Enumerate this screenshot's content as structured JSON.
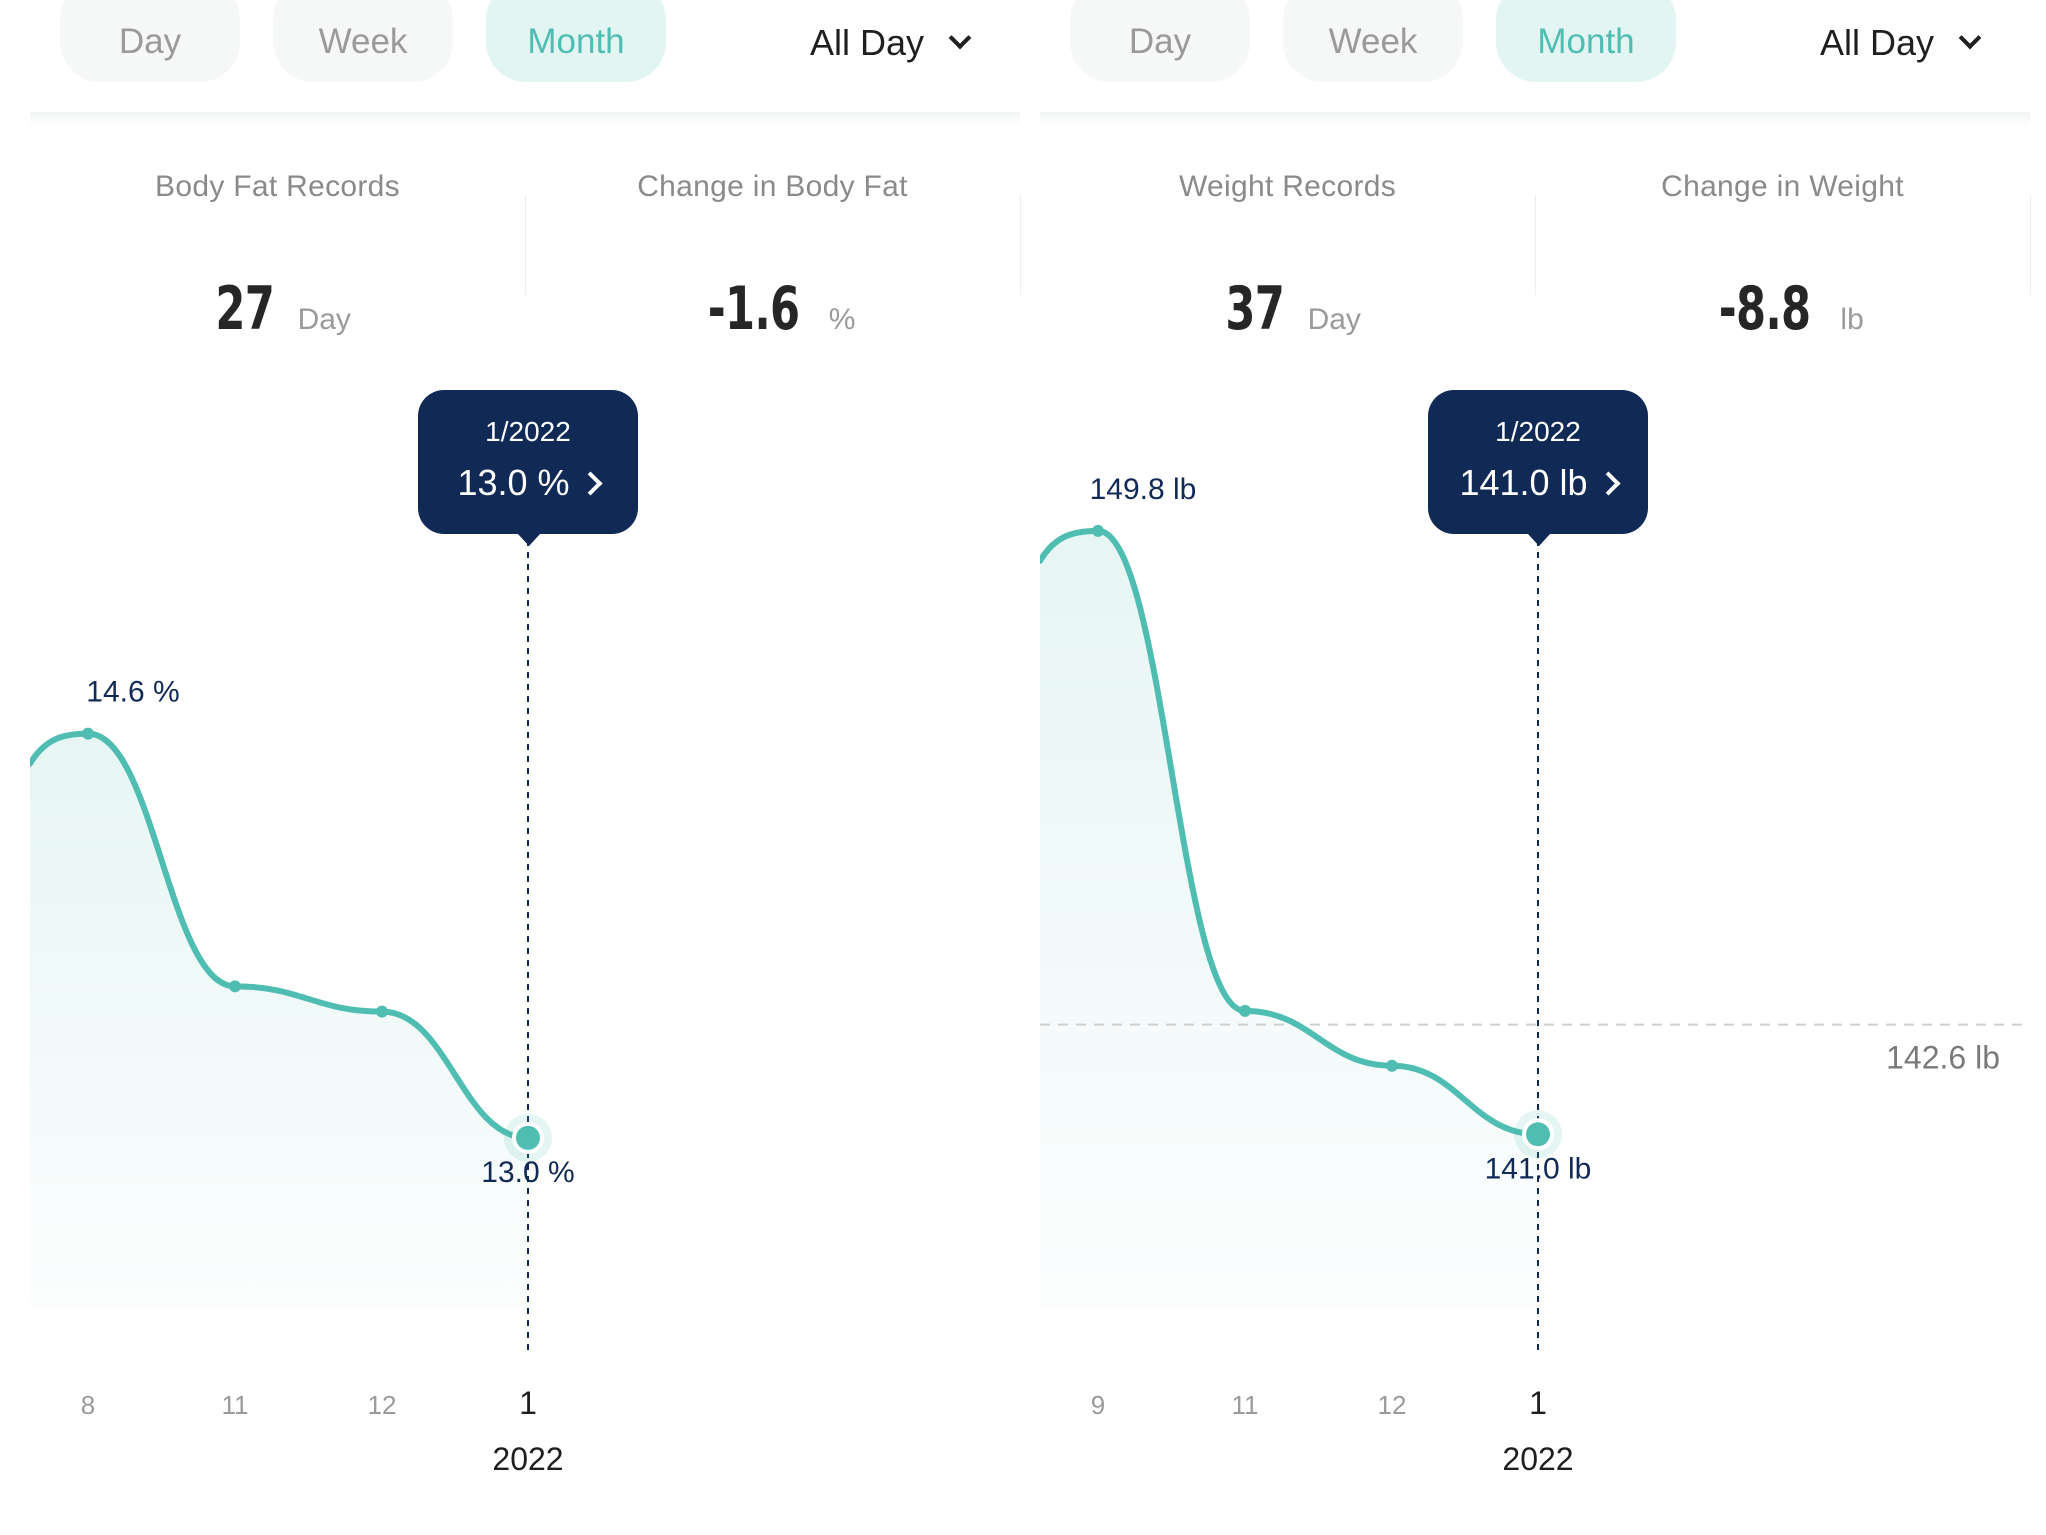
{
  "colors": {
    "accent": "#4fbdb1",
    "tooltip_bg": "#112a55",
    "label_dark": "#112a55",
    "muted": "#9a9a9a"
  },
  "panels": [
    {
      "tabs": [
        "Day",
        "Week",
        "Month"
      ],
      "active_tab": "Month",
      "period_label": "All Day",
      "stat_left": {
        "label": "Body Fat Records",
        "value": "27",
        "unit": "Day"
      },
      "stat_right": {
        "label": "Change in Body Fat",
        "value": "-1.6",
        "unit": "%"
      },
      "tooltip": {
        "date": "1/2022",
        "value": "13.0 %"
      },
      "chart_data": {
        "type": "area",
        "x": [
          "8",
          "11",
          "12",
          "1"
        ],
        "x_year_label": "2022",
        "values": [
          14.6,
          13.6,
          13.5,
          13.0
        ],
        "point_labels": [
          "14.6 %",
          "",
          "",
          "13.0 %"
        ],
        "selected_index": 3,
        "ylim": [
          12.2,
          16.0
        ]
      }
    },
    {
      "tabs": [
        "Day",
        "Week",
        "Month"
      ],
      "active_tab": "Month",
      "period_label": "All Day",
      "stat_left": {
        "label": "Weight Records",
        "value": "37",
        "unit": "Day"
      },
      "stat_right": {
        "label": "Change in Weight",
        "value": "-8.8",
        "unit": "lb"
      },
      "tooltip": {
        "date": "1/2022",
        "value": "141.0 lb"
      },
      "chart_data": {
        "type": "area",
        "x": [
          "9",
          "11",
          "12",
          "1"
        ],
        "x_year_label": "2022",
        "values": [
          149.8,
          142.8,
          142.0,
          141.0
        ],
        "point_labels": [
          "149.8 lb",
          "",
          "",
          "141.0 lb"
        ],
        "selected_index": 3,
        "ylim": [
          138.0,
          152.0
        ],
        "reference_line": {
          "value": 142.6,
          "label": "142.6 lb"
        }
      }
    }
  ]
}
